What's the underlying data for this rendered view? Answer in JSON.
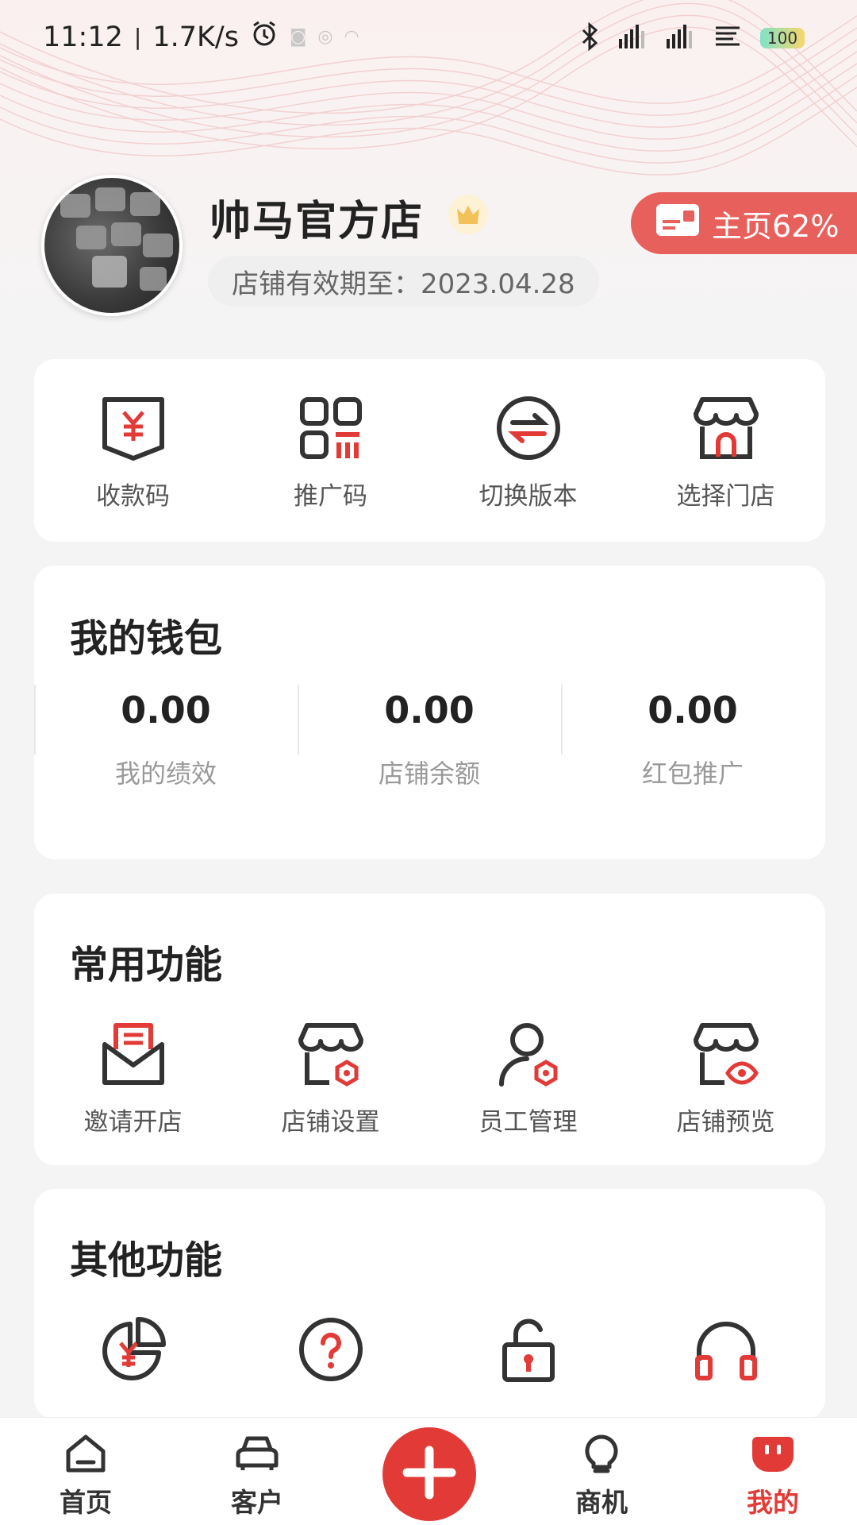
{
  "status_bar": {
    "time": "11:12",
    "net_speed": "1.7K/s",
    "battery": "100"
  },
  "profile": {
    "store_name": "帅马官方店",
    "expire_text": "店铺有效期至：2023.04.28",
    "home_pill_label": "主页62%"
  },
  "quick_actions": [
    {
      "label": "收款码",
      "icon": "payment-code-icon"
    },
    {
      "label": "推广码",
      "icon": "qr-code-icon"
    },
    {
      "label": "切换版本",
      "icon": "switch-icon"
    },
    {
      "label": "选择门店",
      "icon": "store-icon"
    }
  ],
  "wallet": {
    "title": "我的钱包",
    "items": [
      {
        "value": "0.00",
        "label": "我的绩效"
      },
      {
        "value": "0.00",
        "label": "店铺余额"
      },
      {
        "value": "0.00",
        "label": "红包推广"
      }
    ]
  },
  "common": {
    "title": "常用功能",
    "items": [
      {
        "label": "邀请开店",
        "icon": "mail-icon"
      },
      {
        "label": "店铺设置",
        "icon": "store-settings-icon"
      },
      {
        "label": "员工管理",
        "icon": "staff-icon"
      },
      {
        "label": "店铺预览",
        "icon": "store-preview-icon"
      }
    ]
  },
  "other": {
    "title": "其他功能",
    "items": [
      {
        "icon": "finance-chart-icon"
      },
      {
        "icon": "help-icon"
      },
      {
        "icon": "lock-icon"
      },
      {
        "icon": "headset-icon"
      }
    ]
  },
  "bottom_nav": [
    {
      "label": "首页",
      "icon": "home-icon"
    },
    {
      "label": "客户",
      "icon": "customer-icon"
    },
    {
      "label": "",
      "icon": "plus-icon"
    },
    {
      "label": "商机",
      "icon": "opportunity-icon"
    },
    {
      "label": "我的",
      "icon": "mine-icon",
      "active": true
    }
  ],
  "colors": {
    "accent": "#e23b37",
    "pill": "#e8605c",
    "icon_dark": "#333333"
  }
}
